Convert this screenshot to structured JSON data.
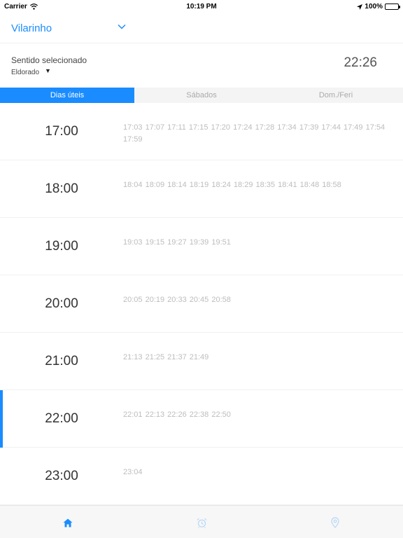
{
  "status_bar": {
    "carrier": "Carrier",
    "time": "10:19 PM",
    "battery": "100%"
  },
  "header": {
    "station": "Vilarinho"
  },
  "direction": {
    "label": "Sentido selecionado",
    "value": "Eldorado",
    "caret": "▼"
  },
  "clock": "22:26",
  "tabs": [
    {
      "label": "Dias úteis",
      "active": true
    },
    {
      "label": "Sábados",
      "active": false
    },
    {
      "label": "Dom./Feri",
      "active": false
    }
  ],
  "schedule": [
    {
      "hour": "17:00",
      "times": "17:03 17:07 17:11 17:15 17:20 17:24 17:28 17:34 17:39 17:44 17:49 17:54 17:59"
    },
    {
      "hour": "18:00",
      "times": "18:04 18:09 18:14 18:19 18:24 18:29 18:35 18:41 18:48 18:58"
    },
    {
      "hour": "19:00",
      "times": "19:03 19:15 19:27 19:39 19:51"
    },
    {
      "hour": "20:00",
      "times": "20:05 20:19 20:33 20:45 20:58"
    },
    {
      "hour": "21:00",
      "times": "21:13 21:25 21:37 21:49"
    },
    {
      "hour": "22:00",
      "times": "22:01 22:13 22:26 22:38 22:50",
      "current": true
    },
    {
      "hour": "23:00",
      "times": "23:04"
    }
  ],
  "tabbar": [
    {
      "icon": "home-icon",
      "active": true
    },
    {
      "icon": "alarm-clock-icon",
      "active": false
    },
    {
      "icon": "location-pin-icon",
      "active": false
    }
  ],
  "colors": {
    "accent": "#1a8cff",
    "inactive": "#b8d7f5",
    "muted_text": "#bdbdbd"
  }
}
